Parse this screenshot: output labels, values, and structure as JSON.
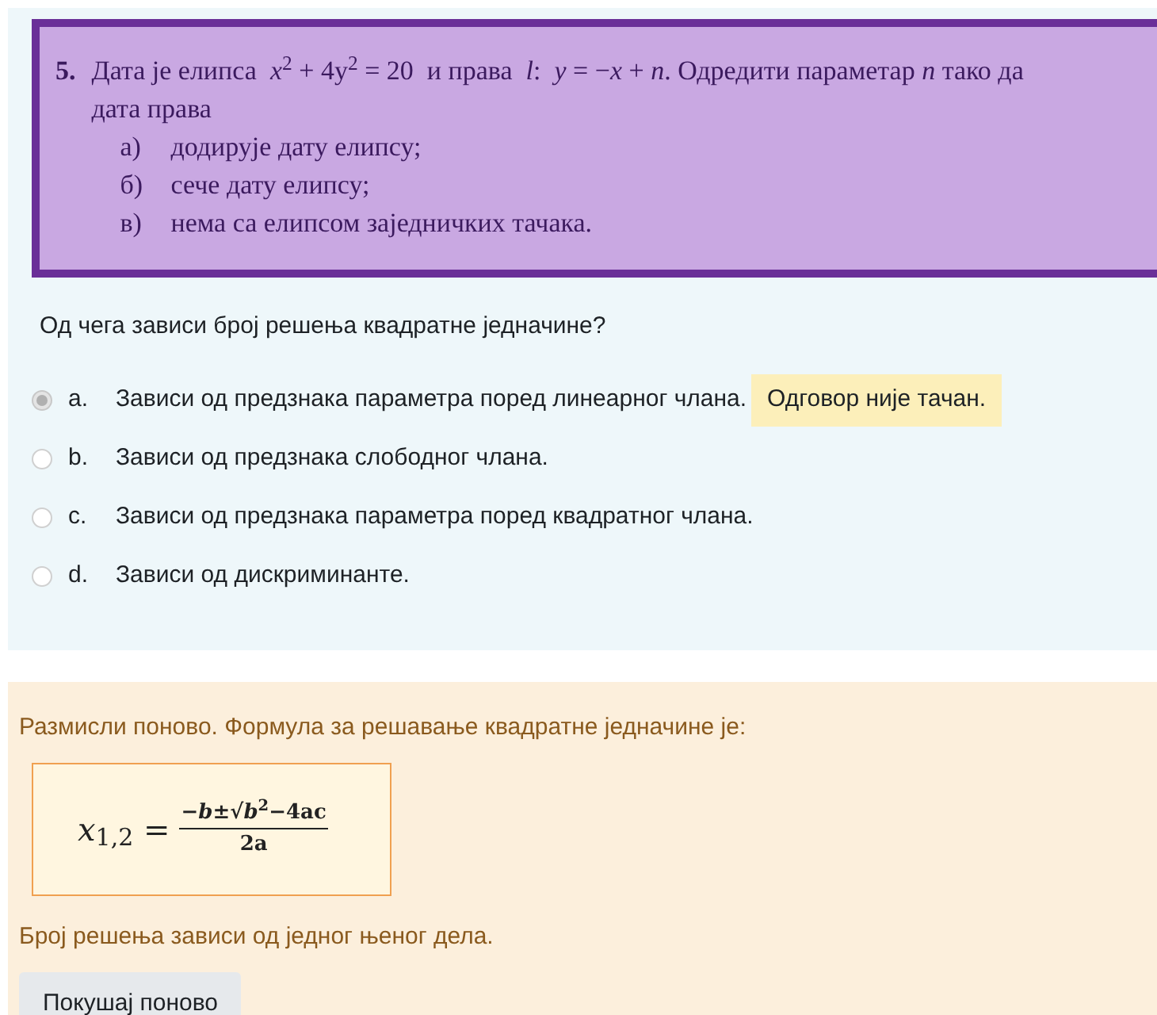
{
  "problem": {
    "number": "5.",
    "intro": "Дата је елипса  *x*$^{2}$ + 4y$^{2}$ = 20  и права  *l*:  *y* = −*x* + *n*. Одредити параметар *n* тако да дата права",
    "items": [
      {
        "label": "а)",
        "text": "додирује дату елипсу;"
      },
      {
        "label": "б)",
        "text": "сече дату елипсу;"
      },
      {
        "label": "в)",
        "text": "нема са елипсом заједничких тачака."
      }
    ]
  },
  "question": "Од чега зависи број решења квадратне једначине?",
  "options": [
    {
      "letter": "a.",
      "text": "Зависи од предзнака параметра поред линеарног члана.",
      "selected": true,
      "feedback": "Одговор није тачан."
    },
    {
      "letter": "b.",
      "text": "Зависи од предзнака слободног члана.",
      "selected": false
    },
    {
      "letter": "c.",
      "text": "Зависи од предзнака параметра поред квадратног члана.",
      "selected": false
    },
    {
      "letter": "d.",
      "text": "Зависи од дискриминанте.",
      "selected": false
    }
  ],
  "hint": {
    "text": "Размисли поново. Формула за решавање квадратне једначине је:",
    "formula": {
      "lhs": "*x*$_{1,2}$ =",
      "numerator": "−*b*±√*b*$^{2}$−4ac",
      "denominator": "2a"
    },
    "after": "Број решења зависи од једног њеног дела.",
    "button": "Покушај поново"
  }
}
